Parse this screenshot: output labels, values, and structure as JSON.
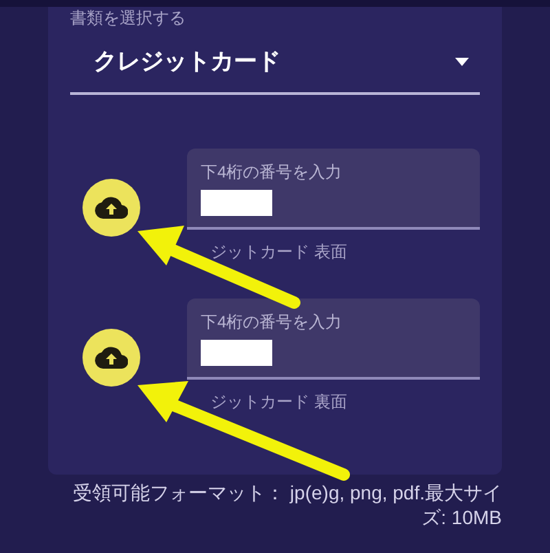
{
  "document_select": {
    "label": "書類を選択する",
    "value": "クレジットカード"
  },
  "uploads": [
    {
      "field_label": "下4桁の番号を入力",
      "caption": "ジットカード 表面"
    },
    {
      "field_label": "下4桁の番号を入力",
      "caption": "ジットカード 裏面"
    }
  ],
  "footer": "受領可能フォーマット： jp(e)g, png, pdf.最大サイズ: 10MB"
}
